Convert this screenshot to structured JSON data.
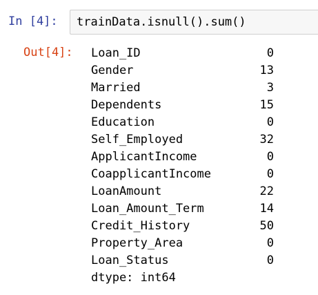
{
  "input": {
    "prompt": "In [4]:",
    "code": "trainData.isnull().sum()"
  },
  "output": {
    "prompt": "Out[4]:",
    "rows": [
      {
        "name": "Loan_ID",
        "count": "0"
      },
      {
        "name": "Gender",
        "count": "13"
      },
      {
        "name": "Married",
        "count": "3"
      },
      {
        "name": "Dependents",
        "count": "15"
      },
      {
        "name": "Education",
        "count": "0"
      },
      {
        "name": "Self_Employed",
        "count": "32"
      },
      {
        "name": "ApplicantIncome",
        "count": "0"
      },
      {
        "name": "CoapplicantIncome",
        "count": "0"
      },
      {
        "name": "LoanAmount",
        "count": "22"
      },
      {
        "name": "Loan_Amount_Term",
        "count": "14"
      },
      {
        "name": "Credit_History",
        "count": "50"
      },
      {
        "name": "Property_Area",
        "count": "0"
      },
      {
        "name": "Loan_Status",
        "count": "0"
      }
    ],
    "dtype": "dtype: int64"
  },
  "colors": {
    "in_prompt": "#303f9f",
    "out_prompt": "#d84315",
    "input_background": "#f7f7f7",
    "input_border": "#cfcfcf"
  }
}
